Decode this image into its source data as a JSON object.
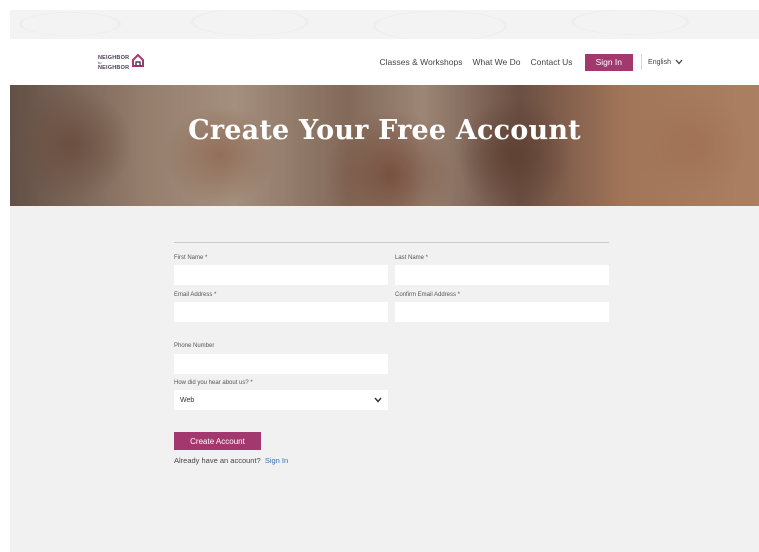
{
  "brand": {
    "logo_line1": "NEIGHBOR",
    "logo_line2": "to",
    "logo_line3": "NEIGHBOR",
    "accent_color": "#a3386f",
    "link_color": "#3a6fb0"
  },
  "nav": {
    "items": [
      {
        "label": "Classes & Workshops"
      },
      {
        "label": "What We Do"
      },
      {
        "label": "Contact Us"
      }
    ],
    "signin_label": "Sign In",
    "language": "English",
    "language_icon": "chevron-down-icon"
  },
  "hero": {
    "title": "Create Your Free Account"
  },
  "form": {
    "first_name": {
      "label": "First Name *",
      "value": ""
    },
    "last_name": {
      "label": "Last Name *",
      "value": ""
    },
    "email": {
      "label": "Email Address *",
      "value": ""
    },
    "confirm_email": {
      "label": "Confirm Email Address *",
      "value": ""
    },
    "phone": {
      "label": "Phone Number",
      "value": ""
    },
    "hear_about": {
      "label": "How did you hear about us? *",
      "selected": "Web",
      "icon": "chevron-down-icon"
    },
    "submit_label": "Create Account",
    "already_text": "Already have an account?",
    "signin_link": "Sign In"
  }
}
